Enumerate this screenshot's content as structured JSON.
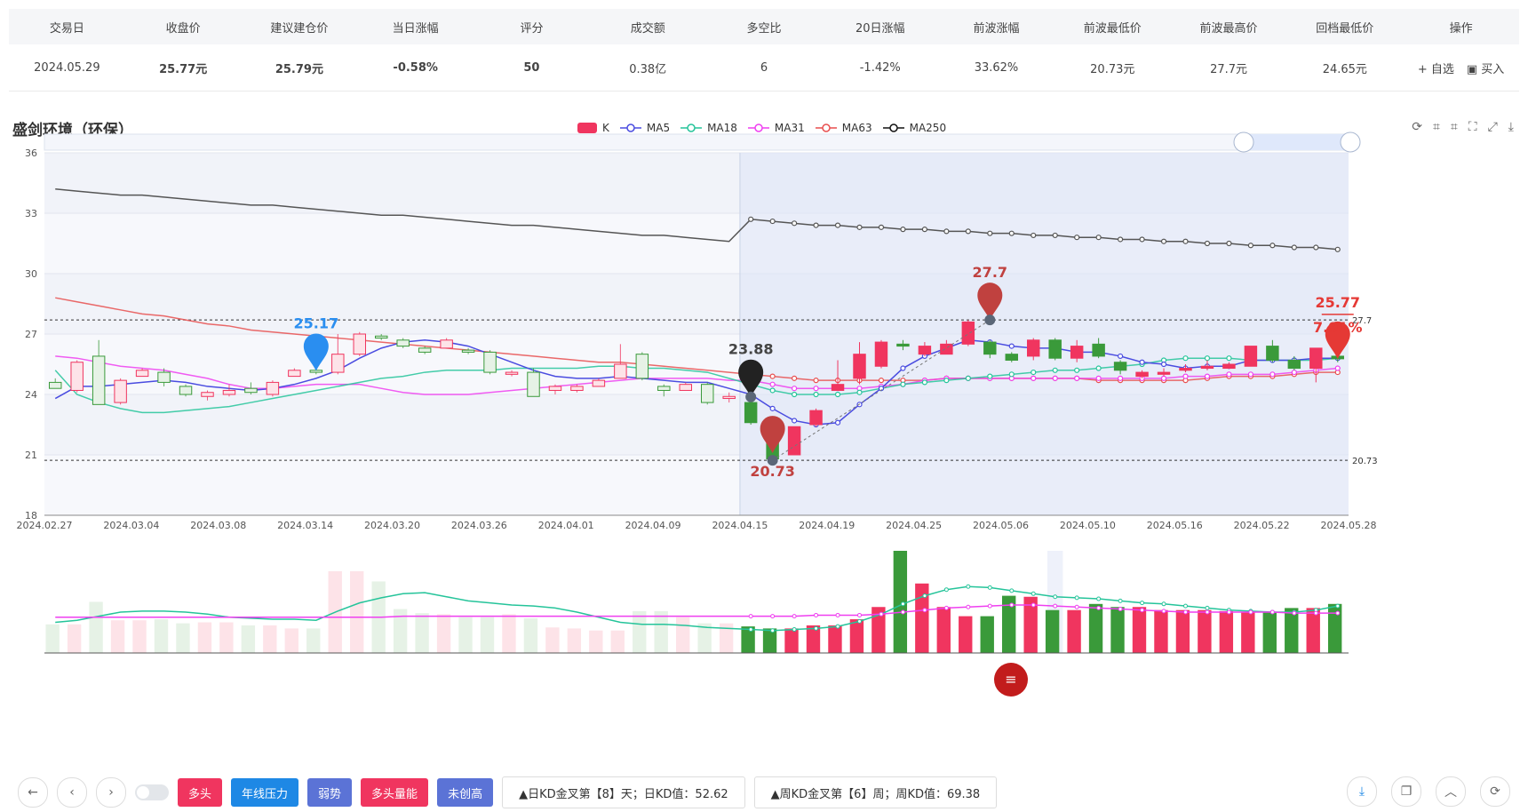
{
  "table": {
    "headers": [
      "交易日",
      "收盘价",
      "建议建仓价",
      "当日涨幅",
      "评分",
      "成交额",
      "多空比",
      "20日涨幅",
      "前波涨幅",
      "前波最低价",
      "前波最高价",
      "回档最低价",
      "操作"
    ],
    "row": {
      "date": "2024.05.29",
      "close": "25.77元",
      "suggest": "25.79元",
      "change": "-0.58%",
      "score": "50",
      "amount": "0.38亿",
      "ratio": "6",
      "change20": "-1.42%",
      "wave_change": "33.62%",
      "wave_low": "20.73元",
      "wave_high": "27.7元",
      "pullback_low": "24.65元",
      "op_add": "+ 自选",
      "op_buy": "买入"
    }
  },
  "chart_title": "盛剑环境（环保）",
  "legend": [
    "K",
    "MA5",
    "MA18",
    "MA31",
    "MA63",
    "MA250"
  ],
  "colors": {
    "up": "#f0355f",
    "down": "#3a9a3a",
    "ma5": "#4a4ce0",
    "ma18": "#25c49a",
    "ma31": "#ef3ff0",
    "ma63": "#e84f4f",
    "ma250": "#555555",
    "accent": "#1e88e5"
  },
  "chart_data": {
    "type": "candlestick",
    "ylim": [
      18,
      36
    ],
    "yticks": [
      18,
      21,
      24,
      27,
      30,
      33,
      36
    ],
    "xlabels": [
      "2024.02.27",
      "2024.03.04",
      "2024.03.08",
      "2024.03.14",
      "2024.03.20",
      "2024.03.26",
      "2024.04.01",
      "2024.04.09",
      "2024.04.15",
      "2024.04.19",
      "2024.04.25",
      "2024.05.06",
      "2024.05.10",
      "2024.05.16",
      "2024.05.22",
      "2024.05.28"
    ],
    "candles": [
      [
        24.6,
        24.3,
        24.8,
        24.3
      ],
      [
        24.2,
        25.6,
        25.7,
        24.1
      ],
      [
        25.9,
        23.5,
        26.7,
        23.5
      ],
      [
        23.6,
        24.7,
        24.8,
        23.5
      ],
      [
        24.9,
        25.2,
        25.3,
        24.9
      ],
      [
        25.1,
        24.6,
        25.3,
        24.4
      ],
      [
        24.4,
        24.0,
        24.5,
        23.9
      ],
      [
        23.9,
        24.1,
        24.2,
        23.7
      ],
      [
        24.0,
        24.2,
        24.5,
        23.9
      ],
      [
        24.3,
        24.1,
        24.6,
        24.0
      ],
      [
        24.0,
        24.6,
        24.7,
        23.9
      ],
      [
        24.9,
        25.2,
        25.3,
        24.9
      ],
      [
        25.2,
        25.1,
        25.4,
        25.0
      ],
      [
        25.1,
        26.0,
        27.0,
        25.0
      ],
      [
        26.0,
        27.0,
        27.1,
        25.9
      ],
      [
        26.9,
        26.8,
        27.0,
        26.7
      ],
      [
        26.7,
        26.4,
        26.8,
        26.3
      ],
      [
        26.3,
        26.1,
        26.4,
        26.0
      ],
      [
        26.3,
        26.7,
        26.8,
        26.3
      ],
      [
        26.2,
        26.1,
        26.3,
        26.0
      ],
      [
        26.1,
        25.1,
        26.2,
        25.0
      ],
      [
        25.0,
        25.1,
        25.2,
        24.9
      ],
      [
        25.1,
        23.9,
        25.3,
        23.9
      ],
      [
        24.2,
        24.4,
        24.5,
        24.0
      ],
      [
        24.2,
        24.4,
        24.5,
        24.1
      ],
      [
        24.4,
        24.7,
        24.8,
        24.4
      ],
      [
        24.8,
        25.5,
        26.5,
        24.8
      ],
      [
        26.0,
        24.8,
        26.1,
        24.7
      ],
      [
        24.4,
        24.2,
        24.5,
        23.9
      ],
      [
        24.2,
        24.5,
        24.6,
        24.2
      ],
      [
        24.5,
        23.6,
        24.6,
        23.5
      ],
      [
        23.8,
        23.9,
        24.1,
        23.6
      ],
      [
        23.6,
        22.6,
        23.7,
        22.5
      ],
      [
        22.6,
        20.8,
        22.8,
        20.73
      ],
      [
        21.0,
        22.4,
        22.4,
        21.0
      ],
      [
        22.5,
        23.2,
        23.3,
        22.4
      ],
      [
        24.2,
        24.5,
        25.7,
        24.3
      ],
      [
        24.8,
        26.0,
        26.6,
        24.5
      ],
      [
        25.4,
        26.6,
        26.7,
        25.3
      ],
      [
        26.5,
        26.4,
        26.7,
        26.2
      ],
      [
        26.0,
        26.4,
        26.6,
        25.9
      ],
      [
        26.0,
        26.5,
        26.7,
        26.0
      ],
      [
        26.5,
        27.6,
        27.7,
        26.4
      ],
      [
        26.6,
        26.0,
        26.7,
        25.8
      ],
      [
        26.0,
        25.7,
        26.1,
        25.6
      ],
      [
        25.9,
        26.7,
        26.8,
        25.7
      ],
      [
        26.7,
        25.8,
        26.8,
        25.7
      ],
      [
        25.8,
        26.4,
        26.7,
        25.6
      ],
      [
        26.5,
        25.9,
        26.8,
        25.8
      ],
      [
        25.6,
        25.2,
        25.7,
        25.0
      ],
      [
        24.9,
        25.1,
        25.2,
        24.8
      ],
      [
        25.0,
        25.1,
        25.3,
        24.9
      ],
      [
        25.2,
        25.3,
        25.5,
        25.1
      ],
      [
        25.3,
        25.4,
        25.7,
        25.2
      ],
      [
        25.3,
        25.5,
        25.6,
        25.3
      ],
      [
        25.4,
        26.4,
        26.4,
        25.4
      ],
      [
        26.4,
        25.7,
        26.7,
        25.6
      ],
      [
        25.7,
        25.3,
        25.9,
        25.2
      ],
      [
        25.3,
        26.3,
        26.3,
        24.6
      ],
      [
        25.9,
        25.77,
        26.6,
        25.6
      ]
    ],
    "ma5": [
      23.8,
      24.4,
      24.4,
      24.5,
      24.6,
      24.7,
      24.6,
      24.4,
      24.3,
      24.2,
      24.3,
      24.5,
      24.8,
      25.2,
      25.8,
      26.3,
      26.6,
      26.7,
      26.6,
      26.4,
      26.0,
      25.6,
      25.2,
      24.9,
      24.8,
      24.8,
      24.9,
      24.8,
      24.7,
      24.6,
      24.6,
      24.3,
      24.0,
      23.3,
      22.7,
      22.5,
      22.6,
      23.5,
      24.3,
      25.3,
      25.9,
      26.3,
      26.7,
      26.6,
      26.4,
      26.3,
      26.3,
      26.1,
      26.1,
      25.9,
      25.6,
      25.5,
      25.3,
      25.4,
      25.4,
      25.7,
      25.7,
      25.7,
      25.8,
      25.8
    ],
    "ma18": [
      25.2,
      24.0,
      23.6,
      23.3,
      23.1,
      23.1,
      23.2,
      23.3,
      23.4,
      23.6,
      23.8,
      24.0,
      24.2,
      24.4,
      24.6,
      24.8,
      24.9,
      25.1,
      25.2,
      25.2,
      25.2,
      25.3,
      25.3,
      25.3,
      25.3,
      25.4,
      25.4,
      25.3,
      25.3,
      25.2,
      25.1,
      24.8,
      24.5,
      24.2,
      24.0,
      24.0,
      24.0,
      24.1,
      24.3,
      24.5,
      24.6,
      24.7,
      24.8,
      24.9,
      25.0,
      25.1,
      25.2,
      25.2,
      25.3,
      25.4,
      25.5,
      25.7,
      25.8,
      25.8,
      25.8,
      25.7,
      25.7,
      25.7,
      25.7,
      25.8
    ],
    "ma31": [
      25.9,
      25.8,
      25.6,
      25.4,
      25.3,
      25.2,
      25.0,
      24.8,
      24.5,
      24.3,
      24.3,
      24.4,
      24.5,
      24.5,
      24.5,
      24.3,
      24.1,
      24.0,
      24.0,
      24.0,
      24.1,
      24.2,
      24.3,
      24.4,
      24.5,
      24.6,
      24.7,
      24.8,
      24.8,
      24.8,
      24.8,
      24.7,
      24.7,
      24.5,
      24.3,
      24.3,
      24.3,
      24.3,
      24.4,
      24.5,
      24.7,
      24.8,
      24.8,
      24.8,
      24.8,
      24.8,
      24.8,
      24.8,
      24.8,
      24.8,
      24.8,
      24.8,
      24.9,
      24.9,
      25.0,
      25.0,
      25.0,
      25.1,
      25.2,
      25.3
    ],
    "ma63": [
      28.8,
      28.6,
      28.4,
      28.2,
      28.0,
      27.9,
      27.7,
      27.5,
      27.4,
      27.2,
      27.1,
      27.0,
      26.9,
      26.8,
      26.7,
      26.6,
      26.5,
      26.4,
      26.3,
      26.2,
      26.1,
      26.0,
      25.9,
      25.8,
      25.7,
      25.6,
      25.6,
      25.5,
      25.4,
      25.3,
      25.2,
      25.1,
      25.0,
      24.9,
      24.8,
      24.7,
      24.7,
      24.7,
      24.7,
      24.7,
      24.7,
      24.8,
      24.8,
      24.8,
      24.8,
      24.8,
      24.8,
      24.8,
      24.7,
      24.7,
      24.7,
      24.7,
      24.7,
      24.8,
      24.9,
      24.9,
      24.9,
      25.0,
      25.1,
      25.1
    ],
    "ma250": [
      34.2,
      34.1,
      34.0,
      33.9,
      33.9,
      33.8,
      33.7,
      33.6,
      33.5,
      33.4,
      33.4,
      33.3,
      33.2,
      33.1,
      33.0,
      32.9,
      32.9,
      32.8,
      32.7,
      32.6,
      32.5,
      32.4,
      32.4,
      32.3,
      32.2,
      32.1,
      32.0,
      31.9,
      31.9,
      31.8,
      31.7,
      31.6,
      32.7,
      32.6,
      32.5,
      32.4,
      32.4,
      32.3,
      32.3,
      32.2,
      32.2,
      32.1,
      32.1,
      32.0,
      32.0,
      31.9,
      31.9,
      31.8,
      31.8,
      31.7,
      31.7,
      31.6,
      31.6,
      31.5,
      31.5,
      31.4,
      31.4,
      31.3,
      31.3,
      31.2
    ],
    "volume": [
      28,
      28,
      50,
      32,
      32,
      33,
      29,
      30,
      30,
      27,
      27,
      24,
      24,
      80,
      80,
      70,
      43,
      39,
      38,
      35,
      35,
      38,
      34,
      25,
      24,
      22,
      22,
      41,
      41,
      35,
      29,
      29,
      26,
      24,
      24,
      27,
      27,
      33,
      45,
      100,
      68,
      45,
      36,
      36,
      56,
      55,
      42,
      42,
      48,
      45,
      45,
      42,
      42,
      42,
      41,
      40,
      40,
      44,
      44,
      48
    ],
    "vol_ma_a": [
      30,
      32,
      36,
      40,
      41,
      41,
      40,
      38,
      35,
      34,
      33,
      33,
      32,
      41,
      49,
      54,
      58,
      59,
      55,
      51,
      49,
      47,
      46,
      44,
      40,
      35,
      30,
      28,
      28,
      27,
      25,
      24,
      23,
      22,
      23,
      24,
      26,
      31,
      38,
      48,
      56,
      62,
      65,
      64,
      61,
      58,
      55,
      54,
      53,
      51,
      49,
      48,
      46,
      44,
      42,
      41,
      40,
      40,
      42,
      46
    ],
    "vol_ma_b": [
      35,
      35,
      35,
      35,
      35,
      35,
      35,
      35,
      35,
      35,
      35,
      35,
      35,
      35,
      35,
      35,
      36,
      36,
      36,
      36,
      36,
      36,
      36,
      36,
      36,
      36,
      36,
      36,
      36,
      36,
      36,
      36,
      36,
      36,
      36,
      37,
      37,
      37,
      38,
      40,
      42,
      44,
      45,
      46,
      47,
      47,
      46,
      45,
      44,
      43,
      42,
      41,
      40,
      40,
      40,
      40,
      40,
      39,
      39,
      39
    ],
    "markers": [
      {
        "label": "25.17",
        "idx": 12,
        "price": 25.17,
        "color": "#2a8ef0"
      },
      {
        "label": "23.88",
        "idx": 32,
        "price": 23.88,
        "color": "#222222"
      },
      {
        "label": "20.73",
        "idx": 33,
        "price": 20.73,
        "color": "#c0413f",
        "below": true
      },
      {
        "label": "27.7",
        "idx": 43,
        "price": 27.7,
        "color": "#c0413f"
      },
      {
        "label": "25.77",
        "idx": 59,
        "price": 25.77,
        "color": "#e53935",
        "pct": "7.91%"
      }
    ],
    "hlines": [
      {
        "value": 27.7,
        "label": "27.7"
      },
      {
        "value": 20.73,
        "label": "20.73"
      }
    ],
    "shade_start_idx": 32
  },
  "bottom": {
    "tags": [
      {
        "label": "多头",
        "color": "#f0355f"
      },
      {
        "label": "年线压力",
        "color": "#1e88e5"
      },
      {
        "label": "弱势",
        "color": "#5b73d6"
      },
      {
        "label": "多头量能",
        "color": "#f0355f"
      },
      {
        "label": "未创高",
        "color": "#5b73d6"
      }
    ],
    "kd_day": "▲日KD金叉第【8】天；日KD值：52.62",
    "kd_week": "▲周KD金叉第【6】周；周KD值：69.38"
  }
}
